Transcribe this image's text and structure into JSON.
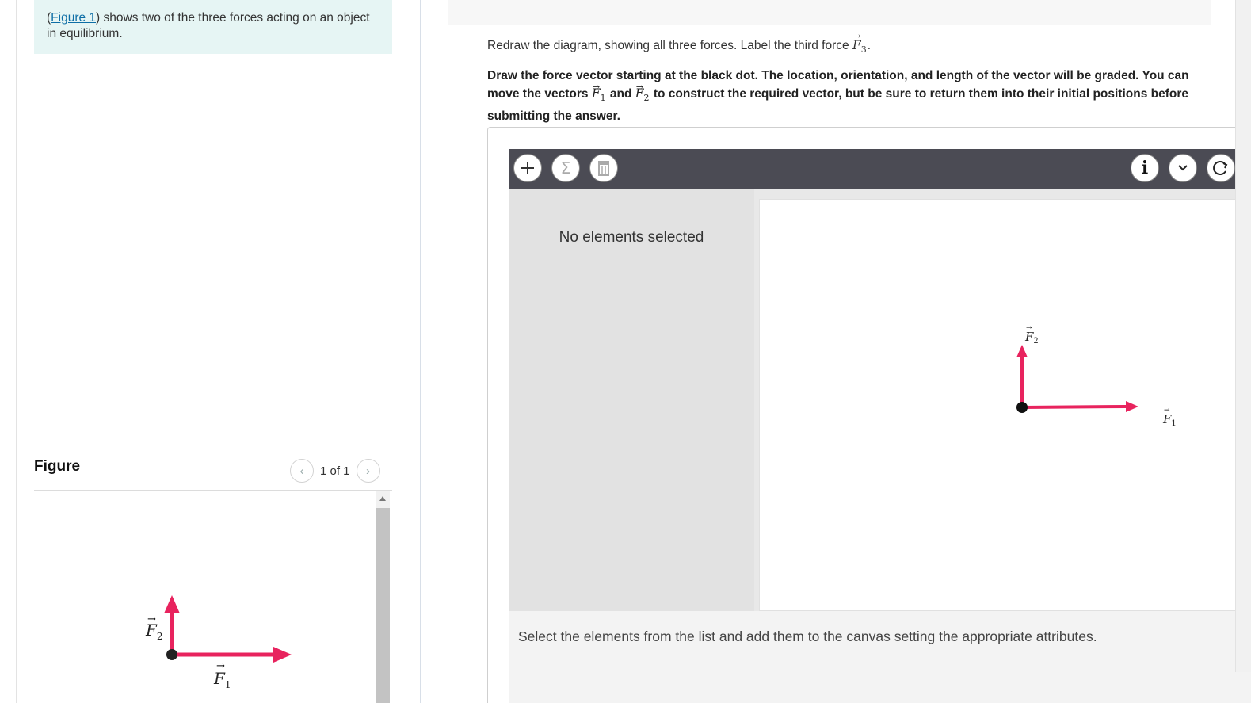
{
  "left": {
    "intro": {
      "open_paren": "(",
      "figure_link": "Figure 1",
      "text": ") shows two of the three forces acting on an object in equilibrium."
    },
    "figure_title": "Figure",
    "pager": {
      "prev_icon": "chevron-left-icon",
      "label": "1 of 1",
      "next_icon": "chevron-right-icon"
    },
    "figure": {
      "f1_label": "F",
      "f1_sub": "1",
      "f2_label": "F",
      "f2_sub": "2",
      "arrow_color": "#e8235e"
    }
  },
  "right": {
    "instruction": {
      "text": "Redraw the diagram, showing all three forces. Label the third force ",
      "vec": "F",
      "sub": "3",
      "end": "."
    },
    "draw": {
      "p1": "Draw the force vector starting at the black dot. The location, orientation, and length of the vector will be graded. You can move the vectors ",
      "f1": "F",
      "f1_sub": "1",
      "and": " and ",
      "f2": "F",
      "f2_sub": "2",
      "p2": " to construct the required vector, but be sure to return them into their initial positions before submitting the answer."
    },
    "toolbar": {
      "left_icons": [
        "plus-icon",
        "sigma-icon",
        "trash-icon"
      ],
      "right_icons": [
        "info-icon",
        "chevron-down-icon",
        "reset-icon"
      ]
    },
    "side_panel_message": "No elements selected",
    "canvas": {
      "f1_label": "F",
      "f1_sub": "1",
      "f2_label": "F",
      "f2_sub": "2",
      "arrow_color": "#e8235e"
    },
    "bottom_message": "Select the elements from the list and add them to the canvas setting the appropriate attributes."
  }
}
